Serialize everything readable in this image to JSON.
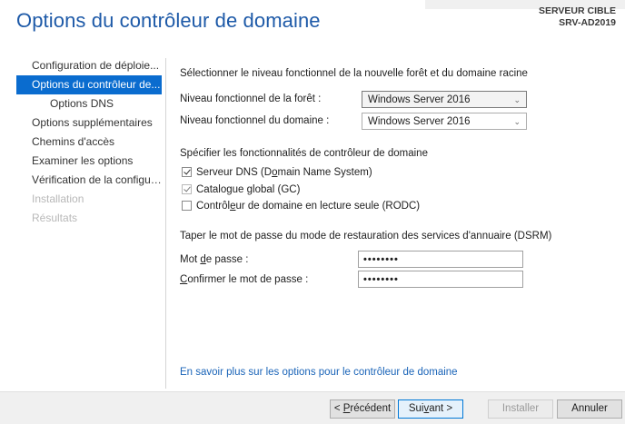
{
  "window": {
    "title": "Options du contrôleur de domaine",
    "target_label": "SERVEUR CIBLE",
    "target_name": "SRV-AD2019"
  },
  "sidebar": {
    "items": [
      {
        "label": "Configuration de déploie...",
        "state": "normal"
      },
      {
        "label": "Options du contrôleur de...",
        "state": "active"
      },
      {
        "label": "Options DNS",
        "state": "normal"
      },
      {
        "label": "Options supplémentaires",
        "state": "normal"
      },
      {
        "label": "Chemins d'accès",
        "state": "normal"
      },
      {
        "label": "Examiner les options",
        "state": "normal"
      },
      {
        "label": "Vérification de la configur...",
        "state": "normal"
      },
      {
        "label": "Installation",
        "state": "disabled"
      },
      {
        "label": "Résultats",
        "state": "disabled"
      }
    ]
  },
  "main": {
    "section1_heading": "Sélectionner le niveau fonctionnel de la nouvelle forêt et du domaine racine",
    "forest_label": "Niveau fonctionnel de la forêt :",
    "forest_value": "Windows Server 2016",
    "domain_label": "Niveau fonctionnel du domaine :",
    "domain_value": "Windows Server 2016",
    "section2_heading": "Spécifier les fonctionnalités de contrôleur de domaine",
    "checkboxes": [
      {
        "label_pre": "Serveur DNS (D",
        "label_u": "o",
        "label_post": "main Name System)",
        "checked": true,
        "disabled": false
      },
      {
        "label_pre": "Catalogue ",
        "label_u": "g",
        "label_post": "lobal (GC)",
        "checked": true,
        "disabled": true
      },
      {
        "label_pre": "Contrôl",
        "label_u": "e",
        "label_post": "ur de domaine en lecture seule (RODC)",
        "checked": false,
        "disabled": false
      }
    ],
    "section3_heading": "Taper le mot de passe du mode de restauration des services d'annuaire (DSRM)",
    "password_label_pre": "Mot ",
    "password_label_u": "d",
    "password_label_post": "e passe :",
    "password_value": "••••••••",
    "confirm_label_u": "C",
    "confirm_label_post": "onfirmer le mot de passe :",
    "confirm_value": "••••••••",
    "more_link": "En savoir plus sur les options pour le contrôleur de domaine"
  },
  "footer": {
    "prev_pre": "< ",
    "prev_u": "P",
    "prev_post": "récédent",
    "next_pre": "Sui",
    "next_u": "v",
    "next_post": "ant >",
    "install_label": "Installer",
    "cancel_label": "Annuler"
  }
}
